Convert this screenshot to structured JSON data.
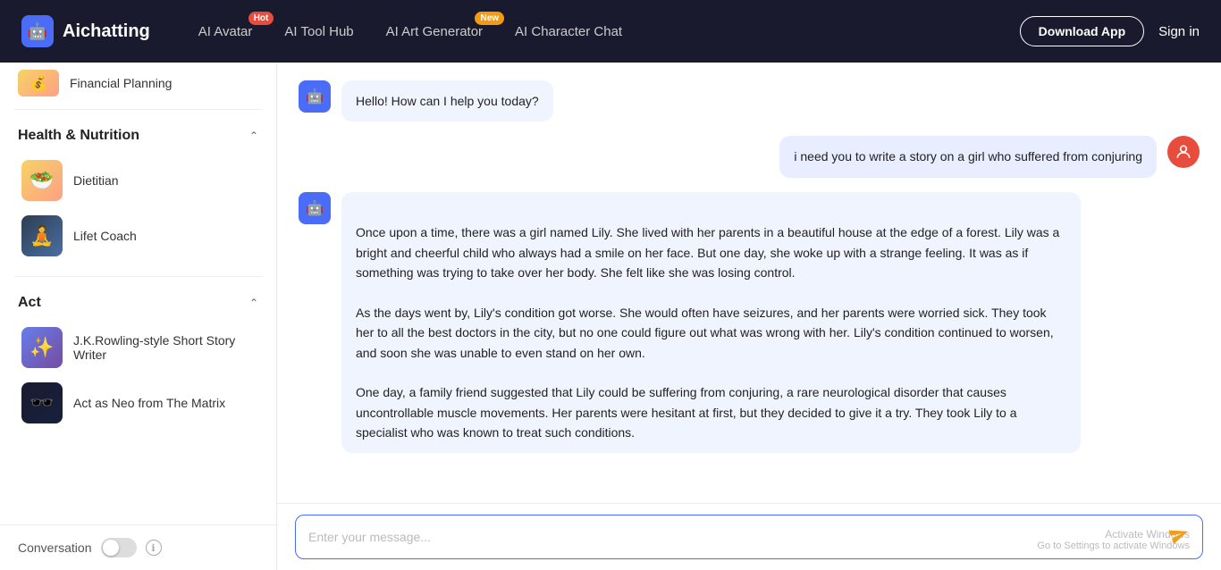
{
  "navbar": {
    "brand": "Aichatting",
    "brand_icon": "🤖",
    "nav_items": [
      {
        "label": "AI Avatar",
        "badge": "Hot",
        "badge_type": "hot"
      },
      {
        "label": "AI Tool Hub",
        "badge": null
      },
      {
        "label": "AI Art Generator",
        "badge": "New",
        "badge_type": "new"
      },
      {
        "label": "AI Character Chat",
        "badge": null
      }
    ],
    "download_btn": "Download App",
    "signin_btn": "Sign in"
  },
  "sidebar": {
    "financial_item": "Financial Planning",
    "health_category": "Health & Nutrition",
    "items_health": [
      {
        "label": "Dietitian",
        "thumb_class": "thumb-dietitian",
        "icon": "🥗"
      },
      {
        "label": "Lifet Coach",
        "thumb_class": "thumb-lifetcoach",
        "icon": "🧘"
      }
    ],
    "act_category": "Act",
    "items_act": [
      {
        "label": "J.K.Rowling-style Short Story Writer",
        "thumb_class": "thumb-jkrowling",
        "icon": "✨"
      },
      {
        "label": "Act as Neo from The Matrix",
        "thumb_class": "thumb-neo",
        "icon": "🕶️"
      }
    ],
    "conversation_label": "Conversation",
    "info_label": "ℹ"
  },
  "chat": {
    "messages": [
      {
        "type": "bot",
        "text": "Hello! How can I help you today?"
      },
      {
        "type": "user",
        "text": "i need you to write a story on a girl who suffered from conjuring"
      },
      {
        "type": "bot",
        "text": "Once upon a time, there was a girl named Lily. She lived with her parents in a beautiful house at the edge of a forest. Lily was a bright and cheerful child who always had a smile on her face. But one day, she woke up with a strange feeling. It was as if something was trying to take over her body. She felt like she was losing control.\n\nAs the days went by, Lily's condition got worse. She would often have seizures, and her parents were worried sick. They took her to all the best doctors in the city, but no one could figure out what was wrong with her. Lily's condition continued to worsen, and soon she was unable to even stand on her own.\n\nOne day, a family friend suggested that Lily could be suffering from conjuring, a rare neurological disorder that causes uncontrollable muscle movements. Her parents were hesitant at first, but they decided to give it a try. They took Lily to a specialist who was known to treat such conditions."
      }
    ],
    "input_placeholder": "Enter your message...",
    "watermark_line1": "Activate Windows",
    "watermark_line2": "Go to Settings to activate Windows"
  }
}
